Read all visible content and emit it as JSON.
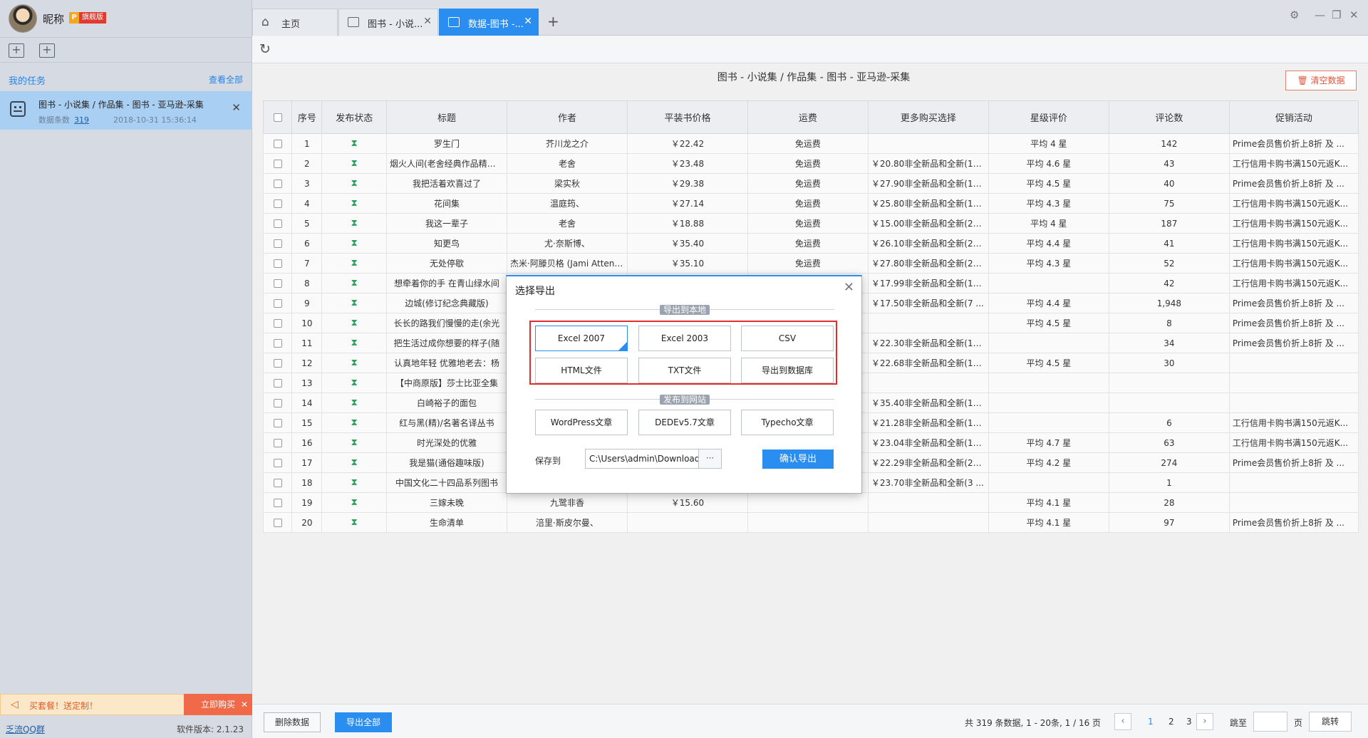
{
  "user": {
    "nickname": "昵称",
    "vip_letter": "P",
    "vip_label": "旗舰版"
  },
  "sidebar": {
    "my_tasks": "我的任务",
    "view_all": "查看全部",
    "task": {
      "title": "图书 - 小说集 / 作品集 - 图书 - 亚马逊-采集",
      "count_label": "数据条数",
      "count": "319",
      "time": "2018-10-31 15:36:14"
    },
    "promo_text": "买套餐！送定制！",
    "buy_now": "立即购买",
    "qq_group": "乏流QQ群",
    "version": "软件版本: 2.1.23"
  },
  "tabs": [
    {
      "label": "主页"
    },
    {
      "label": "图书 - 小说..."
    },
    {
      "label": "数据-图书 -..."
    }
  ],
  "content": {
    "title": "图书 - 小说集 / 作品集 - 图书 - 亚马逊-采集",
    "clear_data": "清空数据",
    "columns": [
      "序号",
      "发布状态",
      "标题",
      "作者",
      "平装书价格",
      "运费",
      "更多购买选择",
      "星级评价",
      "评论数",
      "促销活动"
    ],
    "rows": [
      [
        "1",
        "罗生门",
        "芥川龙之介",
        "￥22.42",
        "免运费",
        "",
        "平均 4 星",
        "142",
        "Prime会员售价折上8折 及 ..."
      ],
      [
        "2",
        "烟火人间(老舍经典作品精选...",
        "老舍",
        "￥23.48",
        "免运费",
        "￥20.80非全新品和全新(19...",
        "平均 4.6 星",
        "43",
        "工行信用卡购书满150元返K..."
      ],
      [
        "3",
        "我把活着欢喜过了",
        "梁实秋",
        "￥29.38",
        "免运费",
        "￥27.90非全新品和全新(15...",
        "平均 4.5 星",
        "40",
        "Prime会员售价折上8折 及 ..."
      ],
      [
        "4",
        "花间集",
        "温庭筠、",
        "￥27.14",
        "免运费",
        "￥25.80非全新品和全新(19...",
        "平均 4.3 星",
        "75",
        "工行信用卡购书满150元返K..."
      ],
      [
        "5",
        "我这一辈子",
        "老舍",
        "￥18.88",
        "免运费",
        "￥15.00非全新品和全新(22...",
        "平均 4 星",
        "187",
        "工行信用卡购书满150元返K..."
      ],
      [
        "6",
        "知更鸟",
        "尤·奈斯博、",
        "￥35.40",
        "免运费",
        "￥26.10非全新品和全新(24...",
        "平均 4.4 星",
        "41",
        "工行信用卡购书满150元返K..."
      ],
      [
        "7",
        "无处停歇",
        "杰米·阿滕贝格 (Jami Attenb...",
        "￥35.10",
        "免运费",
        "￥27.80非全新品和全新(21...",
        "平均 4.3 星",
        "52",
        "工行信用卡购书满150元返K..."
      ],
      [
        "8",
        "想牵着你的手 在青山绿水间",
        "",
        "",
        "",
        "￥17.99非全新品和全新(10...",
        "",
        "42",
        "工行信用卡购书满150元返K..."
      ],
      [
        "9",
        "边城(修订纪念典藏版)",
        "",
        "",
        "",
        "￥17.50非全新品和全新(7 ...",
        "平均 4.4 星",
        "1,948",
        "Prime会员售价折上8折 及 ..."
      ],
      [
        "10",
        "长长的路我们慢慢的走(余光",
        "",
        "",
        "",
        "",
        "平均 4.5 星",
        "8",
        "Prime会员售价折上8折 及 ..."
      ],
      [
        "11",
        "把生活过成你想要的样子(随",
        "",
        "",
        "",
        "￥22.30非全新品和全新(10...",
        "",
        "34",
        "Prime会员售价折上8折 及 ..."
      ],
      [
        "12",
        "认真地年轻 优雅地老去：杨",
        "",
        "",
        "",
        "￥22.68非全新品和全新(11...",
        "平均 4.5 星",
        "30",
        ""
      ],
      [
        "13",
        "【中商原版】莎士比亚全集",
        "",
        "",
        "",
        "",
        "",
        "",
        ""
      ],
      [
        "14",
        "白崎裕子的面包",
        "",
        "",
        "",
        "￥35.40非全新品和全新(17...",
        "",
        "",
        ""
      ],
      [
        "15",
        "红与黑(精)/名著名译丛书",
        "",
        "",
        "",
        "￥21.28非全新品和全新(10...",
        "",
        "6",
        "工行信用卡购书满150元返K..."
      ],
      [
        "16",
        "时光深处的优雅",
        "",
        "",
        "",
        "￥23.04非全新品和全新(14...",
        "平均 4.7 星",
        "63",
        "工行信用卡购书满150元返K..."
      ],
      [
        "17",
        "我是猫(通俗趣味版)",
        "",
        "",
        "",
        "￥22.29非全新品和全新(21...",
        "平均 4.2 星",
        "274",
        "Prime会员售价折上8折 及 ..."
      ],
      [
        "18",
        "中国文化二十四品系列图书",
        "",
        "",
        "",
        "￥23.70非全新品和全新(3 ...",
        "",
        "1",
        ""
      ],
      [
        "19",
        "三嫁未晚",
        "九鹭非香",
        "￥15.60",
        "",
        "",
        "平均 4.1 星",
        "28",
        ""
      ],
      [
        "20",
        "生命清单",
        "涪里·斯皮尔曼、",
        "",
        "",
        "",
        "平均 4.1 星",
        "97",
        "Prime会员售价折上8折 及 ..."
      ]
    ]
  },
  "bottom": {
    "delete_data": "删除数据",
    "export_all": "导出全部",
    "pager_info": "共 319 条数据, 1 - 20条, 1 / 16 页",
    "pages": [
      "1",
      "2",
      "3"
    ],
    "goto_label": "跳至",
    "page_unit": "页",
    "goto_button": "跳转"
  },
  "modal": {
    "title": "选择导出",
    "local_section": "导出到本地",
    "local_options": [
      "Excel 2007",
      "Excel 2003",
      "CSV",
      "HTML文件",
      "TXT文件",
      "导出到数据库"
    ],
    "web_section": "发布到网站",
    "web_options": [
      "WordPress文章",
      "DEDEv5.7文章",
      "Typecho文章"
    ],
    "save_label": "保存到",
    "save_path": "C:\\Users\\admin\\Downloads\\图书 - 小",
    "browse": "···",
    "confirm": "确认导出"
  },
  "colors": {
    "accent": "#2a8df0",
    "highlight_border": "#e02d2d",
    "status_green": "#2aa15a"
  },
  "icons": [
    "home-icon",
    "tab-page-icon",
    "close-icon",
    "plus-icon",
    "settings-icon",
    "minimize-icon",
    "restore-icon",
    "refresh-icon",
    "hourglass-icon",
    "robot-icon",
    "speaker-icon",
    "trash-icon"
  ]
}
